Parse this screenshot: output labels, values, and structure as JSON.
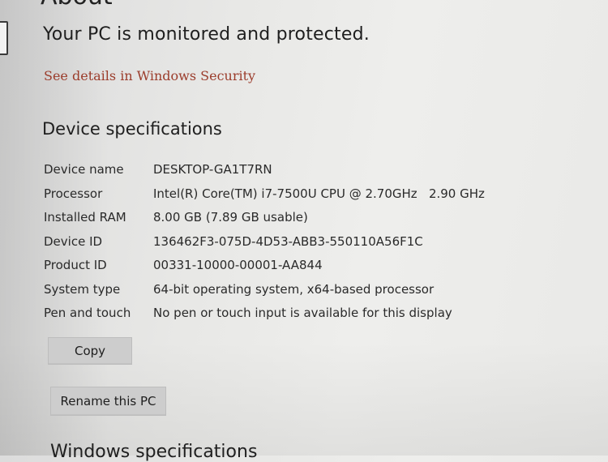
{
  "page": {
    "cropped_heading": "About",
    "headline": "Your PC is monitored and protected.",
    "security_link": "See details in Windows Security"
  },
  "device_specifications": {
    "title": "Device specifications",
    "rows": [
      {
        "label": "Device name",
        "value": "DESKTOP-GA1T7RN"
      },
      {
        "label": "Processor",
        "value": "Intel(R) Core(TM) i7-7500U CPU @ 2.70GHz   2.90 GHz"
      },
      {
        "label": "Installed RAM",
        "value": "8.00 GB (7.89 GB usable)"
      },
      {
        "label": "Device ID",
        "value": "136462F3-075D-4D53-ABB3-550110A56F1C"
      },
      {
        "label": "Product ID",
        "value": "00331-10000-00001-AA844"
      },
      {
        "label": "System type",
        "value": "64-bit operating system, x64-based processor"
      },
      {
        "label": "Pen and touch",
        "value": "No pen or touch input is available for this display"
      }
    ],
    "copy_button": "Copy"
  },
  "actions": {
    "rename_button": "Rename this PC"
  },
  "windows_specifications": {
    "title": "Windows specifications"
  },
  "colors": {
    "link": "#9b3c2b",
    "button_bg": "#cdcdcd"
  }
}
